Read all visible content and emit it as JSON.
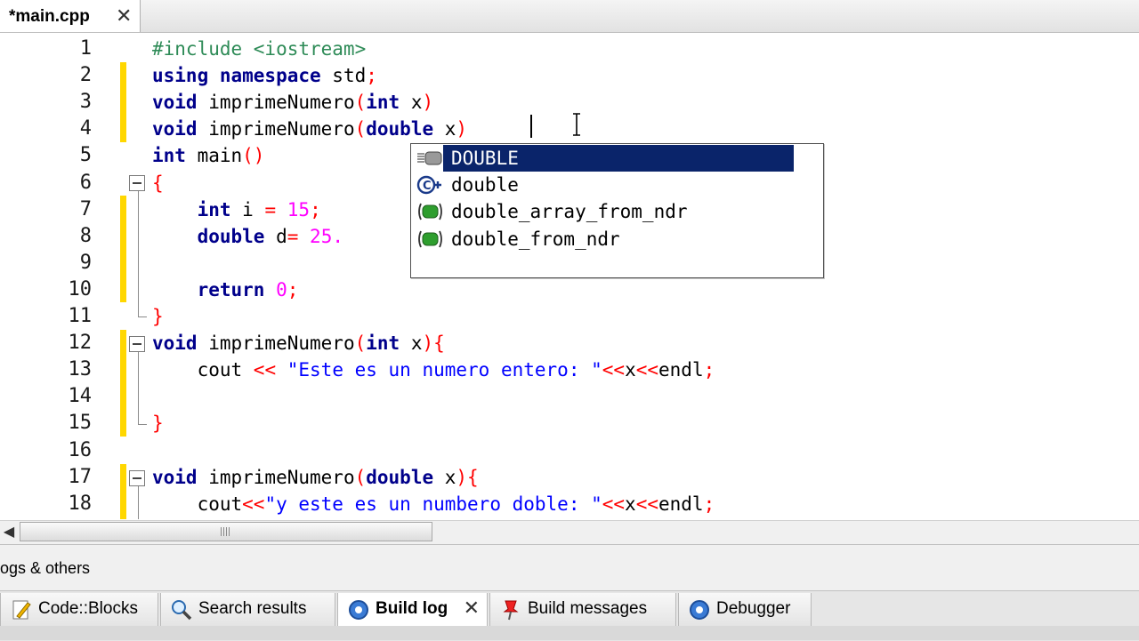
{
  "file_tab": {
    "name": "*main.cpp",
    "close": "✕"
  },
  "code_lines": [
    {
      "num": "1",
      "segments": [
        [
          "pp",
          "#include <iostream>"
        ]
      ]
    },
    {
      "num": "2",
      "segments": [
        [
          "kw",
          "using namespace"
        ],
        [
          "",
          " std"
        ],
        [
          "op",
          ";"
        ]
      ]
    },
    {
      "num": "3",
      "segments": [
        [
          "kw",
          "void"
        ],
        [
          "",
          " imprimeNumero"
        ],
        [
          "op",
          "("
        ],
        [
          "kw",
          "int"
        ],
        [
          "",
          " x"
        ],
        [
          "op",
          ")"
        ]
      ]
    },
    {
      "num": "4",
      "segments": [
        [
          "kw",
          "void"
        ],
        [
          "",
          " imprimeNumero"
        ],
        [
          "op",
          "("
        ],
        [
          "kw",
          "double"
        ],
        [
          "",
          " x"
        ],
        [
          "op",
          ")"
        ]
      ]
    },
    {
      "num": "5",
      "segments": [
        [
          "kw",
          "int"
        ],
        [
          "",
          " main"
        ],
        [
          "op",
          "()"
        ]
      ]
    },
    {
      "num": "6",
      "segments": [
        [
          "op",
          "{"
        ]
      ]
    },
    {
      "num": "7",
      "segments": [
        [
          "",
          "    "
        ],
        [
          "kw",
          "int"
        ],
        [
          "",
          " i "
        ],
        [
          "op",
          "="
        ],
        [
          "",
          " "
        ],
        [
          "num",
          "15"
        ],
        [
          "op",
          ";"
        ]
      ]
    },
    {
      "num": "8",
      "segments": [
        [
          "",
          "    "
        ],
        [
          "kw",
          "double"
        ],
        [
          "",
          " d"
        ],
        [
          "op",
          "="
        ],
        [
          "",
          " "
        ],
        [
          "num",
          "25."
        ]
      ]
    },
    {
      "num": "9",
      "segments": []
    },
    {
      "num": "10",
      "segments": [
        [
          "",
          "    "
        ],
        [
          "kw",
          "return"
        ],
        [
          "",
          " "
        ],
        [
          "num",
          "0"
        ],
        [
          "op",
          ";"
        ]
      ]
    },
    {
      "num": "11",
      "segments": [
        [
          "op",
          "}"
        ]
      ]
    },
    {
      "num": "12",
      "segments": [
        [
          "kw",
          "void"
        ],
        [
          "",
          " imprimeNumero"
        ],
        [
          "op",
          "("
        ],
        [
          "kw",
          "int"
        ],
        [
          "",
          " x"
        ],
        [
          "op",
          "){"
        ]
      ]
    },
    {
      "num": "13",
      "segments": [
        [
          "",
          "    cout "
        ],
        [
          "op",
          "<<"
        ],
        [
          "",
          " "
        ],
        [
          "str",
          "\"Este es un numero entero: \""
        ],
        [
          "op",
          "<<"
        ],
        [
          "",
          "x"
        ],
        [
          "op",
          "<<"
        ],
        [
          "",
          "endl"
        ],
        [
          "op",
          ";"
        ]
      ]
    },
    {
      "num": "14",
      "segments": []
    },
    {
      "num": "15",
      "segments": [
        [
          "op",
          "}"
        ]
      ]
    },
    {
      "num": "16",
      "segments": []
    },
    {
      "num": "17",
      "segments": [
        [
          "kw",
          "void"
        ],
        [
          "",
          " imprimeNumero"
        ],
        [
          "op",
          "("
        ],
        [
          "kw",
          "double"
        ],
        [
          "",
          " x"
        ],
        [
          "op",
          "){"
        ]
      ]
    },
    {
      "num": "18",
      "segments": [
        [
          "",
          "    cout"
        ],
        [
          "op",
          "<<"
        ],
        [
          "str",
          "\"y este es un numbero doble: \""
        ],
        [
          "op",
          "<<"
        ],
        [
          "",
          "x"
        ],
        [
          "op",
          "<<"
        ],
        [
          "",
          "endl"
        ],
        [
          "op",
          ";"
        ]
      ]
    }
  ],
  "autocomplete": {
    "items": [
      {
        "label": "DOUBLE",
        "icon": "macro-icon",
        "selected": true
      },
      {
        "label": "double",
        "icon": "class-icon",
        "selected": false
      },
      {
        "label": "double_array_from_ndr",
        "icon": "function-icon",
        "selected": false
      },
      {
        "label": "double_from_ndr",
        "icon": "function-icon",
        "selected": false
      }
    ]
  },
  "logs_panel": {
    "title": "ogs & others",
    "tabs": [
      {
        "label": "Code::Blocks",
        "icon": "document-pencil-icon",
        "active": false
      },
      {
        "label": "Search results",
        "icon": "magnifier-icon",
        "active": false
      },
      {
        "label": "Build log",
        "icon": "gear-icon",
        "active": true,
        "close": "✕"
      },
      {
        "label": "Build messages",
        "icon": "pin-icon",
        "active": false
      },
      {
        "label": "Debugger",
        "icon": "debug-gear-icon",
        "active": false
      }
    ]
  },
  "colors": {
    "keyword": "#00008b",
    "operator": "#ff0000",
    "number": "#ff00ff",
    "string": "#0000ff",
    "preprocessor": "#2e8b57",
    "change_marker": "#ffd700",
    "selection": "#0a246a"
  }
}
